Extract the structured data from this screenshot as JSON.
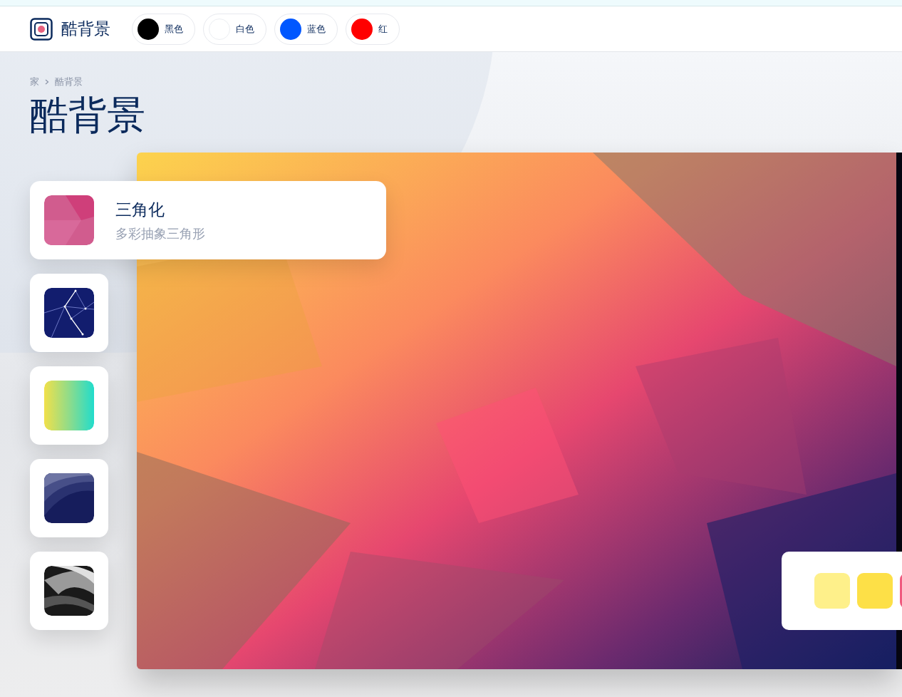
{
  "header": {
    "logo": "酷背景",
    "colors": [
      {
        "label": "黑色",
        "color": "#000000"
      },
      {
        "label": "白色",
        "color": "#ffffff"
      },
      {
        "label": "蓝色",
        "color": "#0057ff"
      },
      {
        "label": "红",
        "color": "#ff0000"
      }
    ]
  },
  "breadcrumb": [
    "家",
    "酷背景"
  ],
  "title": "酷背景",
  "styles": [
    {
      "kind": "triangles",
      "title": "三角化",
      "subtitle": "多彩抽象三角形",
      "expanded": true
    },
    {
      "kind": "constellation",
      "expanded": false
    },
    {
      "kind": "gradient",
      "expanded": false
    },
    {
      "kind": "waves",
      "expanded": false
    },
    {
      "kind": "swirl",
      "expanded": false
    }
  ],
  "palette": [
    {
      "color": "#fef08a"
    },
    {
      "color": "#fde047"
    },
    {
      "color": "#f05a7e"
    }
  ]
}
